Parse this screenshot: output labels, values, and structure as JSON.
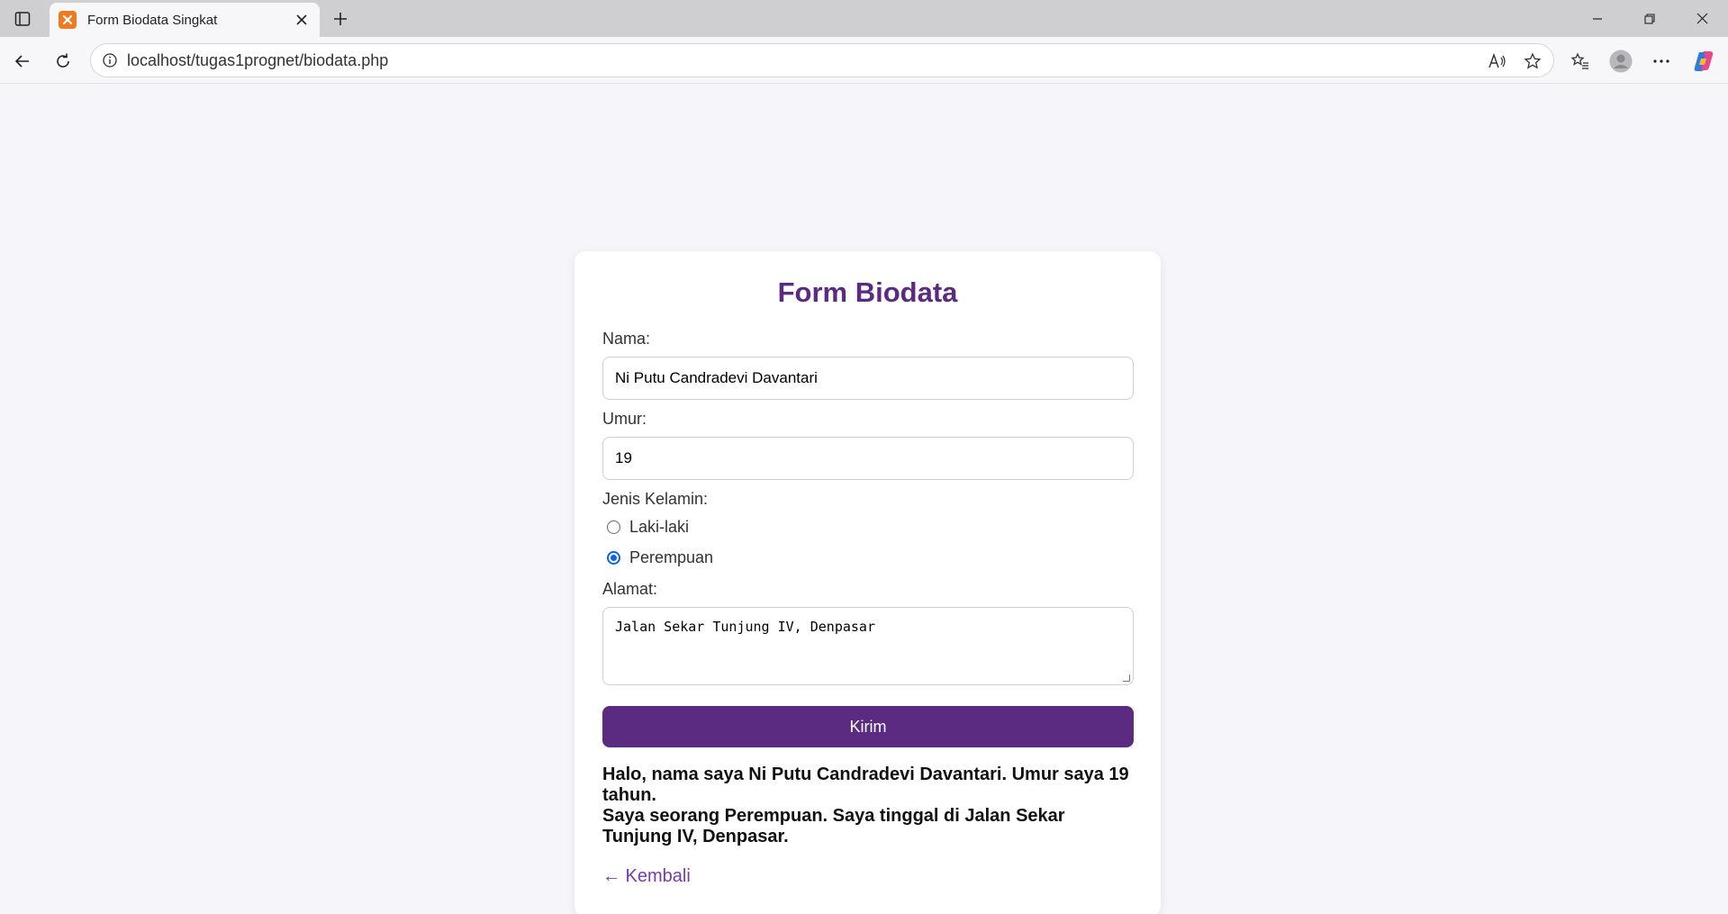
{
  "browser": {
    "tab_title": "Form Biodata Singkat",
    "url": "localhost/tugas1prognet/biodata.php"
  },
  "form": {
    "title": "Form Biodata",
    "nama_label": "Nama:",
    "nama_value": "Ni Putu Candradevi Davantari",
    "umur_label": "Umur:",
    "umur_value": "19",
    "gender_label": "Jenis Kelamin:",
    "gender_options": [
      "Laki-laki",
      "Perempuan"
    ],
    "gender_selected": "Perempuan",
    "alamat_label": "Alamat:",
    "alamat_value": "Jalan Sekar Tunjung IV, Denpasar",
    "submit_label": "Kirim"
  },
  "result": {
    "line1": "Halo, nama saya Ni Putu Candradevi Davantari. Umur saya 19 tahun.",
    "line2": "Saya seorang Perempuan. Saya tinggal di Jalan Sekar Tunjung IV, Denpasar."
  },
  "back_link": "← Kembali",
  "colors": {
    "accent": "#5a2b80",
    "link": "#7a3aa8",
    "radio_checked": "#0a66d9",
    "background": "#f5f5fa"
  }
}
